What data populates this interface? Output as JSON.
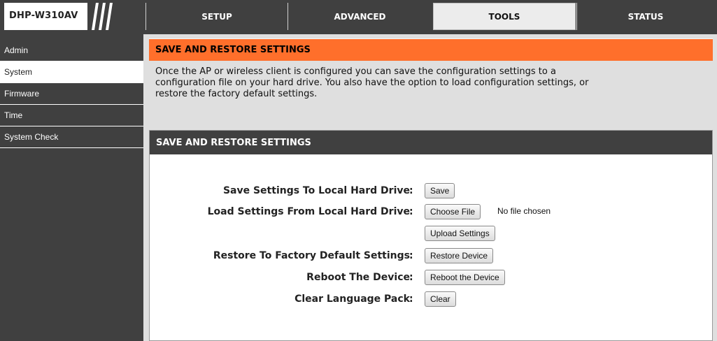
{
  "brand": {
    "model": "DHP-W310AV"
  },
  "tabs": [
    {
      "label": "SETUP",
      "active": false
    },
    {
      "label": "ADVANCED",
      "active": false
    },
    {
      "label": "TOOLS",
      "active": true
    },
    {
      "label": "STATUS",
      "active": false
    }
  ],
  "sidebar": {
    "items": [
      {
        "label": "Admin",
        "active": false
      },
      {
        "label": "System",
        "active": true
      },
      {
        "label": "Firmware",
        "active": false
      },
      {
        "label": "Time",
        "active": false
      },
      {
        "label": "System Check",
        "active": false
      }
    ]
  },
  "info": {
    "title": "SAVE AND RESTORE SETTINGS",
    "line1": "Once the AP or wireless client is configured you can save the configuration settings to a",
    "line2": "configuration file on your hard drive. You also have the option to load configuration settings, or",
    "line3": "restore the factory default settings."
  },
  "settings": {
    "title": "SAVE AND RESTORE SETTINGS",
    "save_label": "Save Settings To Local Hard Drive",
    "save_button": "Save",
    "load_label": "Load Settings From Local Hard Drive",
    "choose_file_button": "Choose File",
    "no_file_text": "No file chosen",
    "upload_button": "Upload Settings",
    "restore_label": "Restore To Factory Default Settings",
    "restore_button": "Restore Device",
    "reboot_label": "Reboot The Device",
    "reboot_button": "Reboot the Device",
    "clear_label": "Clear Language Pack",
    "clear_button": "Clear",
    "colon": ":"
  },
  "colors": {
    "header_bg": "#404040",
    "accent_orange": "#ff6f2b",
    "main_bg": "#dfdfdf"
  }
}
